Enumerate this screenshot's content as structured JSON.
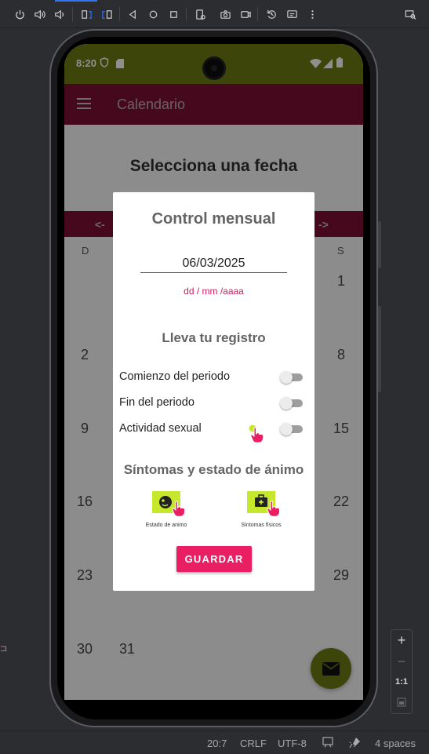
{
  "ide": {
    "toolbar_icons": [
      "power-icon",
      "volume-up-icon",
      "volume-down-icon",
      "rotate-left-icon",
      "rotate-right-icon",
      "back-icon",
      "home-icon",
      "overview-icon",
      "device-settings-icon",
      "camera-icon",
      "record-icon",
      "reset-icon",
      "snapshot-icon",
      "more-icon",
      "device-explorer-icon"
    ],
    "statusbar": {
      "position": "20:7",
      "line_ending": "CRLF",
      "encoding": "UTF-8",
      "indent": "4 spaces"
    },
    "zoom": {
      "plus": "+",
      "minus": "−",
      "ratio": "1:1"
    }
  },
  "device": {
    "status_time": "8:20",
    "app_bar": {
      "title": "Calendario"
    },
    "calendar": {
      "heading": "Selecciona una fecha",
      "prev": "<-",
      "next": "->",
      "dow_first": "D",
      "dow_last": "S",
      "days": [
        "1",
        "2",
        "8",
        "9",
        "15",
        "16",
        "22",
        "23",
        "29",
        "30",
        "31"
      ]
    },
    "dialog": {
      "title": "Control mensual",
      "date_value": "06/03/2025",
      "date_hint": "dd / mm /aaaa",
      "section_registro": "Lleva tu registro",
      "switches": [
        {
          "label": "Comienzo del periodo",
          "on": false
        },
        {
          "label": "Fin del periodo",
          "on": false
        },
        {
          "label": "Actividad sexual",
          "on": false
        }
      ],
      "section_sintomas": "Síntomas y estado de ánimo",
      "options": [
        {
          "label": "Estado de animo",
          "icon": "mood-face-icon"
        },
        {
          "label": "Síntomas físicos",
          "icon": "medical-kit-icon"
        }
      ],
      "save_label": "GUARDAR"
    },
    "colors": {
      "status_bar": "#6d7b12",
      "app_bar": "#7d0f33",
      "accent": "#e91e63",
      "icon_bg": "#c6e82c"
    }
  }
}
